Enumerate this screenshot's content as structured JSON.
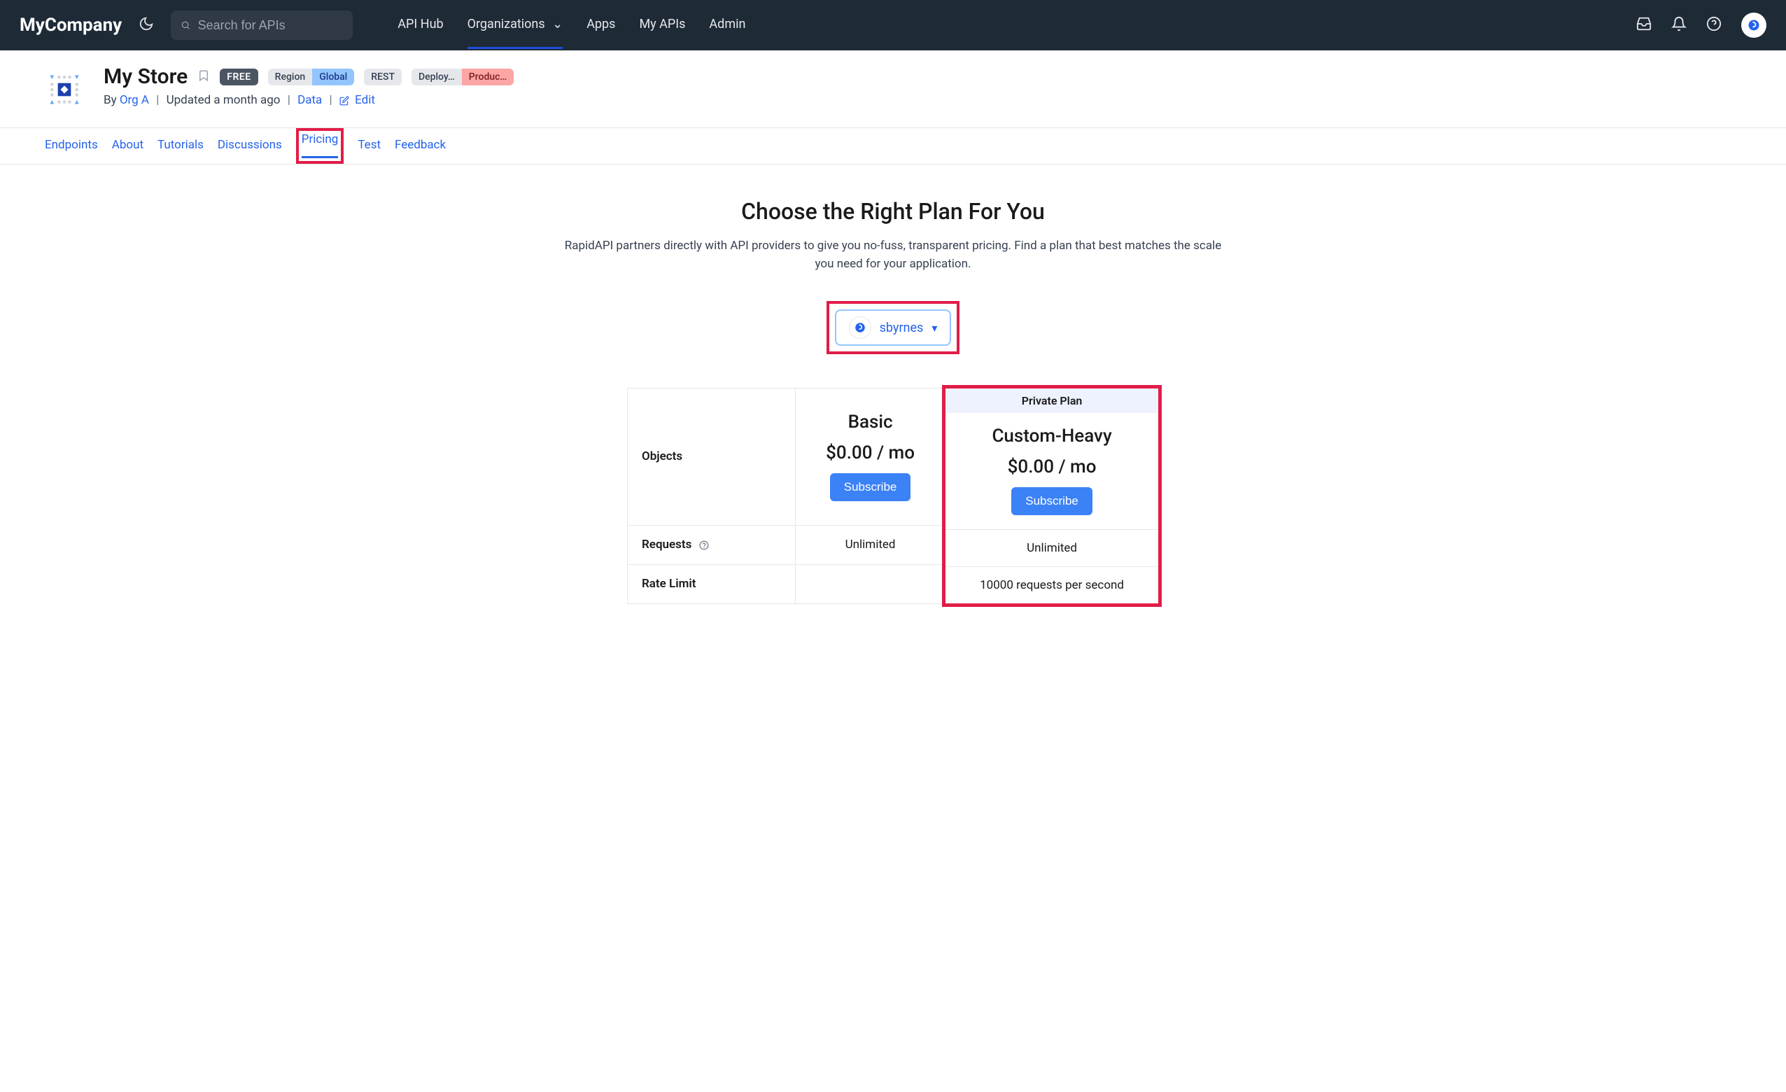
{
  "brand": "MyCompany",
  "search": {
    "placeholder": "Search for APIs"
  },
  "nav": {
    "hub": "API Hub",
    "orgs": "Organizations",
    "apps": "Apps",
    "myapis": "My APIs",
    "admin": "Admin"
  },
  "api": {
    "title": "My Store",
    "free": "FREE",
    "region_label": "Region",
    "region_value": "Global",
    "rest": "REST",
    "deploy": "Deploy…",
    "produc": "Produc…",
    "by": "By",
    "org": "Org A",
    "updated": "Updated a month ago",
    "data": "Data",
    "edit": "Edit"
  },
  "tabs": {
    "endpoints": "Endpoints",
    "about": "About",
    "tutorials": "Tutorials",
    "discussions": "Discussions",
    "pricing": "Pricing",
    "test": "Test",
    "feedback": "Feedback"
  },
  "page": {
    "title": "Choose the Right Plan For You",
    "subtitle": "RapidAPI partners directly with API providers to give you no-fuss, transparent pricing. Find a plan that best matches the scale you need for your application."
  },
  "user_select": "sbyrnes",
  "plans": {
    "objects": "Objects",
    "requests": "Requests",
    "rate_limit": "Rate Limit",
    "basic": {
      "name": "Basic",
      "price": "$0.00 / mo",
      "subscribe": "Subscribe",
      "requests": "Unlimited",
      "rate_limit": ""
    },
    "custom": {
      "private": "Private Plan",
      "name": "Custom-Heavy",
      "price": "$0.00 / mo",
      "subscribe": "Subscribe",
      "requests": "Unlimited",
      "rate_limit": "10000 requests per second"
    }
  }
}
